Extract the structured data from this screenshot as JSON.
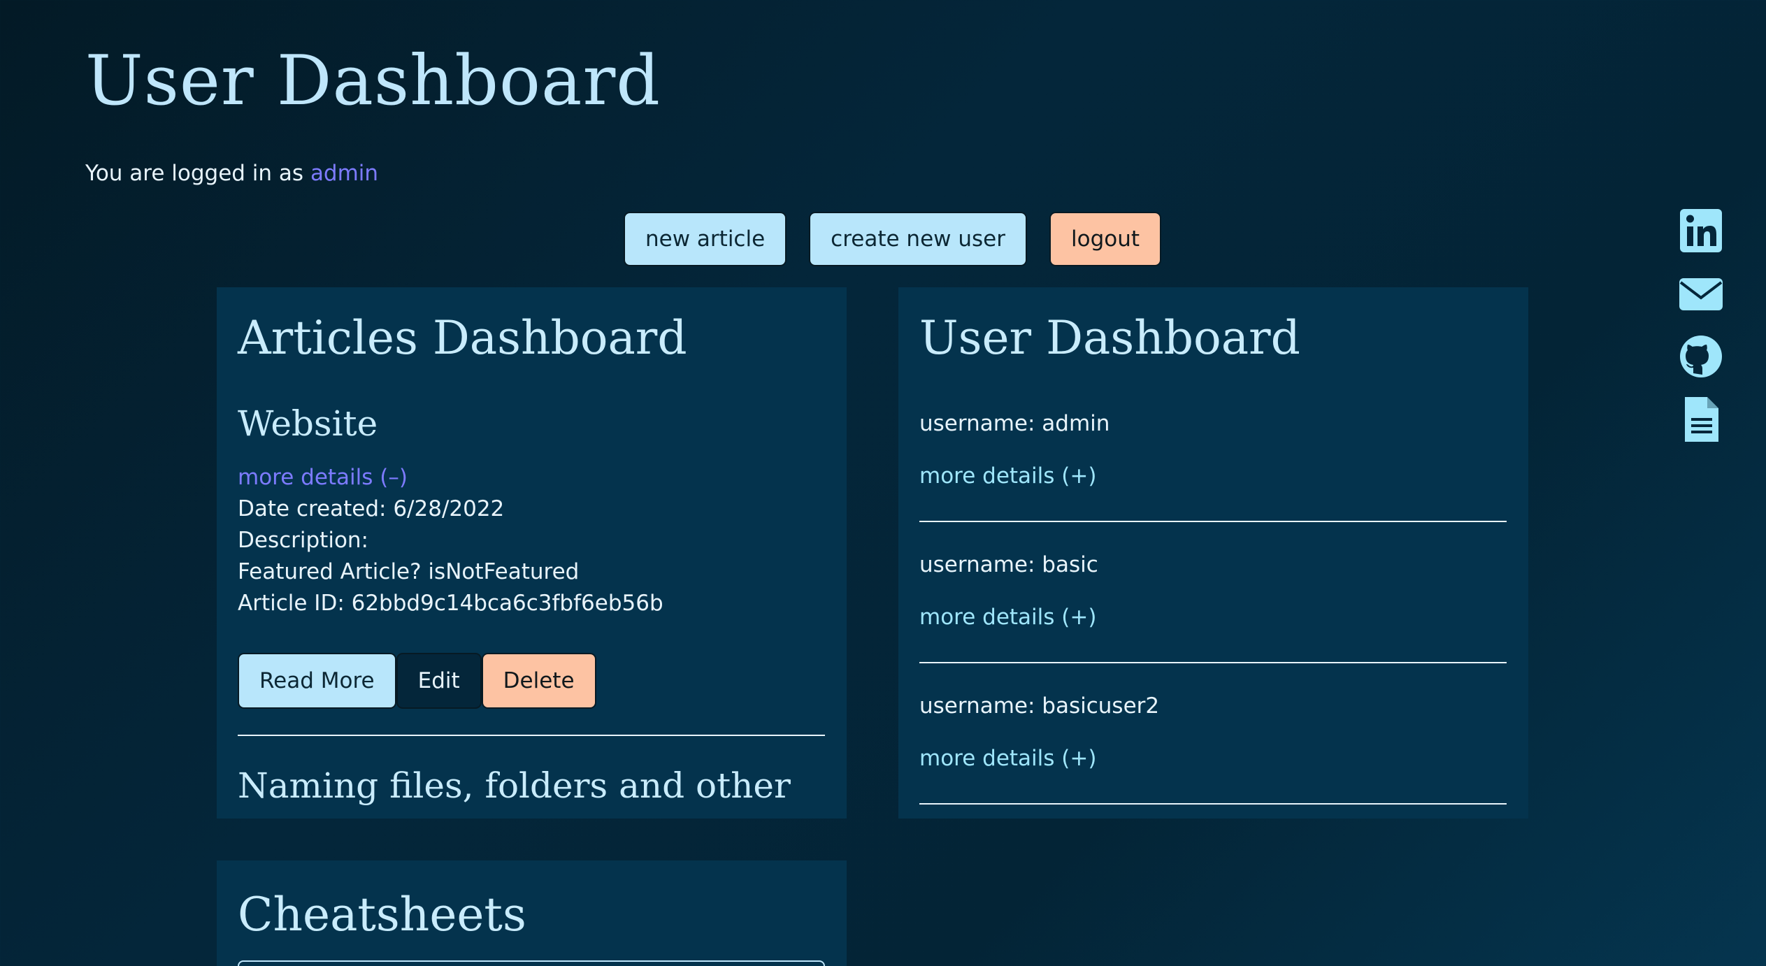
{
  "header": {
    "title": "User Dashboard",
    "login_prefix": "You are logged in as",
    "username": "admin"
  },
  "actions": {
    "new_article": "new article",
    "create_user": "create new user",
    "logout": "logout"
  },
  "articles": {
    "title": "Articles Dashboard",
    "items": [
      {
        "title": "Website",
        "details_toggle": "more details (–)",
        "date_created": "Date created: 6/28/2022",
        "description": "Description:",
        "featured": "Featured Article? isNotFeatured",
        "article_id": "Article ID: 62bbd9c14bca6c3fbf6eb56b",
        "read_more": "Read More",
        "edit": "Edit",
        "delete": "Delete"
      },
      {
        "title": "Naming files, folders and other"
      }
    ]
  },
  "users": {
    "title": "User Dashboard",
    "items": [
      {
        "username": "username: admin",
        "details_toggle": "more details (+)"
      },
      {
        "username": "username: basic",
        "details_toggle": "more details (+)"
      },
      {
        "username": "username: basicuser2",
        "details_toggle": "more details (+)"
      }
    ]
  },
  "cheatsheets": {
    "title": "Cheatsheets"
  },
  "social": {
    "icons": [
      "linkedin-icon",
      "email-icon",
      "github-icon",
      "document-icon"
    ]
  },
  "colors": {
    "accent_light": "#b8e6fb",
    "accent_peach": "#fdc3a3",
    "link_purple": "#7d7bff",
    "link_cyan": "#9fe6fb",
    "panel_bg": "#04334d"
  }
}
